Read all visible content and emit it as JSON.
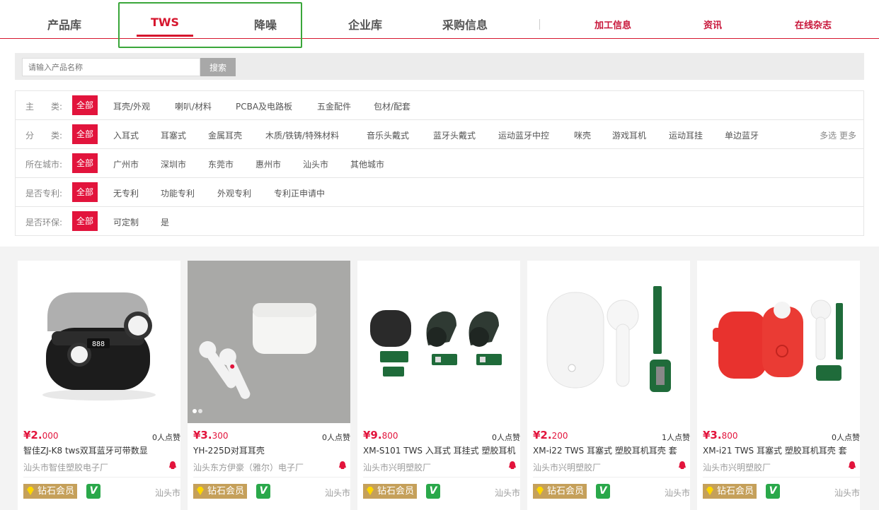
{
  "nav": {
    "items": [
      "产品库",
      "TWS",
      "降噪",
      "企业库",
      "采购信息"
    ],
    "right_items": [
      "加工信息",
      "资讯",
      "在线杂志"
    ],
    "active": "TWS"
  },
  "search": {
    "placeholder": "请输入产品名称",
    "button": "搜索"
  },
  "filters": [
    {
      "label": "主　　类:",
      "all": "全部",
      "options": [
        "耳壳/外观",
        "喇叭/材料",
        "PCBA及电路板",
        "五金配件",
        "包材/配套"
      ]
    },
    {
      "label": "分　　类:",
      "all": "全部",
      "options": [
        "入耳式",
        "耳塞式",
        "金属耳壳",
        "木质/铁铸/特殊材料",
        "音乐头戴式",
        "蓝牙头戴式",
        "运动蓝牙中控",
        "咪壳",
        "游戏耳机",
        "运动耳挂",
        "单边蓝牙"
      ],
      "more": "多选 更多"
    },
    {
      "label": "所在城市:",
      "all": "全部",
      "options": [
        "广州市",
        "深圳市",
        "东莞市",
        "惠州市",
        "汕头市",
        "其他城市"
      ]
    },
    {
      "label": "是否专利:",
      "all": "全部",
      "options": [
        "无专利",
        "功能专利",
        "外观专利",
        "专利正申请中"
      ]
    },
    {
      "label": "是否环保:",
      "all": "全部",
      "options": [
        "可定制",
        "是"
      ]
    }
  ],
  "products": [
    {
      "price_int": "¥2.",
      "price_dec": "000",
      "likes": "0人点赞",
      "title": "智佳ZJ-K8 tws双耳蓝牙可带数显",
      "company": "汕头市智佳塑胶电子厂",
      "badge": "钻石会员",
      "v": "V",
      "city": "汕头市"
    },
    {
      "price_int": "¥3.",
      "price_dec": "300",
      "likes": "0人点赞",
      "title": "YH-225D对耳耳壳",
      "company": "汕头东方伊豪（雅尔）电子厂",
      "badge": "钻石会员",
      "v": "V",
      "city": "汕头市"
    },
    {
      "price_int": "¥9.",
      "price_dec": "800",
      "likes": "0人点赞",
      "title": "XM-S101 TWS 入耳式 耳挂式 塑胶耳机",
      "company": "汕头市兴明塑胶厂",
      "badge": "钻石会员",
      "v": "V",
      "city": "汕头市"
    },
    {
      "price_int": "¥2.",
      "price_dec": "200",
      "likes": "1人点赞",
      "title": "XM-i22 TWS 耳塞式 塑胶耳机耳壳 套",
      "company": "汕头市兴明塑胶厂",
      "badge": "钻石会员",
      "v": "V",
      "city": "汕头市"
    },
    {
      "price_int": "¥3.",
      "price_dec": "800",
      "likes": "0人点赞",
      "title": "XM-i21 TWS 耳塞式 塑胶耳机耳壳 套",
      "company": "汕头市兴明塑胶厂",
      "badge": "钻石会员",
      "v": "V",
      "city": "汕头市"
    }
  ],
  "colors": {
    "accent": "#e2143c",
    "nav_red": "#c8163a",
    "vip_gold": "#c5a05a",
    "verified_green": "#2aa84a",
    "highlight_box": "#3aa63a"
  }
}
